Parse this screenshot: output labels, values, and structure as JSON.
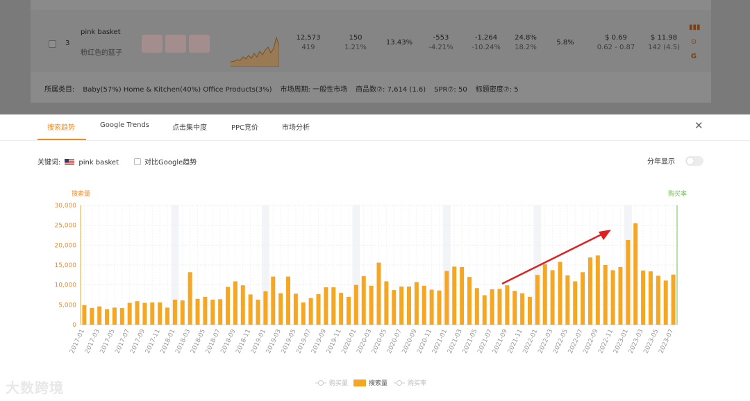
{
  "product_row": {
    "rank": "3",
    "name_en": "pink basket",
    "name_cn": "粉红色的篮子",
    "search_volume": "12,573",
    "search_volume_sub": "419",
    "purchases": "150",
    "purchases_sub": "1.21%",
    "purchase_rate": "13.43%",
    "change1": "-553",
    "change1_sub": "-4.21%",
    "change2": "-1,264",
    "change2_sub": "-10.24%",
    "click_share": "24.8%",
    "click_share_sub": "18.2%",
    "conversion": "5.8%",
    "ppc": "$ 0.69",
    "ppc_sub": "0.62 - 0.87",
    "price": "$ 11.98",
    "price_sub": "142 (4.5)"
  },
  "meta": {
    "category_label": "所属类目:",
    "categories": "Baby(57%)   Home & Kitchen(40%)   Office Products(3%)",
    "cycle": "市场周期: 一般性市场",
    "product_count": "商品数⑦: 7,614 (1.6)",
    "spr": "SPR⑦: 50",
    "title_density": "标题密度⑦: 5"
  },
  "tabs": [
    "搜索趋势",
    "Google Trends",
    "点击集中度",
    "PPC竞价",
    "市场分析"
  ],
  "keyword_label": "关键词:",
  "keyword": "pink basket",
  "compare_label": "对比Google趋势",
  "yearly_label": "分年显示",
  "watermark": "大数跨境",
  "colors": {
    "accent": "#f08a24",
    "bar": "#f5a623",
    "right_axis": "#6cc24a"
  },
  "chart_data": {
    "type": "bar",
    "ylabel_left": "搜索量",
    "ylabel_right": "购买率",
    "ylim": [
      0,
      30000
    ],
    "yticks": [
      "0",
      "5,000",
      "10,000",
      "15,000",
      "20,000",
      "25,000",
      "30,000"
    ],
    "legend": [
      "购买量",
      "搜索量",
      "购买率"
    ],
    "categories": [
      "2017-01",
      "2017-02",
      "2017-03",
      "2017-04",
      "2017-05",
      "2017-06",
      "2017-07",
      "2017-08",
      "2017-09",
      "2017-10",
      "2017-11",
      "2017-12",
      "2018-01",
      "2018-02",
      "2018-03",
      "2018-04",
      "2018-05",
      "2018-06",
      "2018-07",
      "2018-08",
      "2018-09",
      "2018-10",
      "2018-11",
      "2018-12",
      "2019-01",
      "2019-02",
      "2019-03",
      "2019-04",
      "2019-05",
      "2019-06",
      "2019-07",
      "2019-08",
      "2019-09",
      "2019-10",
      "2019-11",
      "2019-12",
      "2020-01",
      "2020-02",
      "2020-03",
      "2020-04",
      "2020-05",
      "2020-06",
      "2020-07",
      "2020-08",
      "2020-09",
      "2020-10",
      "2020-11",
      "2020-12",
      "2021-01",
      "2021-02",
      "2021-03",
      "2021-04",
      "2021-05",
      "2021-06",
      "2021-07",
      "2021-08",
      "2021-09",
      "2021-10",
      "2021-11",
      "2021-12",
      "2022-01",
      "2022-02",
      "2022-03",
      "2022-04",
      "2022-05",
      "2022-06",
      "2022-07",
      "2022-08",
      "2022-09",
      "2022-10",
      "2022-11",
      "2022-12",
      "2023-01",
      "2023-02",
      "2023-03",
      "2023-04",
      "2023-05",
      "2023-06",
      "2023-07"
    ],
    "xticks": [
      "2017-01",
      "2017-03",
      "2017-05",
      "2017-07",
      "2017-09",
      "2017-11",
      "2018-01",
      "2018-03",
      "2018-05",
      "2018-07",
      "2018-09",
      "2018-11",
      "2019-01",
      "2019-03",
      "2019-05",
      "2019-07",
      "2019-09",
      "2019-11",
      "2020-01",
      "2020-03",
      "2020-05",
      "2020-07",
      "2020-09",
      "2020-11",
      "2021-01",
      "2021-03",
      "2021-05",
      "2021-07",
      "2021-09",
      "2021-11",
      "2022-01",
      "2022-03",
      "2022-05",
      "2022-07",
      "2022-09",
      "2022-11",
      "2023-01",
      "2023-03",
      "2023-05",
      "2023-07"
    ],
    "series": [
      {
        "name": "搜索量",
        "values": [
          4900,
          4200,
          4600,
          3900,
          4300,
          4200,
          5500,
          5900,
          5500,
          5600,
          5600,
          4300,
          6300,
          6100,
          13200,
          6500,
          7000,
          6300,
          6400,
          9500,
          10900,
          9900,
          7600,
          6300,
          8400,
          12100,
          7900,
          12100,
          7800,
          5600,
          6700,
          7700,
          9400,
          9400,
          8000,
          7000,
          10000,
          12200,
          9800,
          15600,
          10900,
          8700,
          9600,
          9600,
          10700,
          9800,
          8800,
          8600,
          13500,
          14600,
          14500,
          12000,
          9200,
          7400,
          8900,
          9000,
          9900,
          8500,
          7900,
          7000,
          12500,
          15200,
          13700,
          15800,
          12400,
          10900,
          13200,
          16900,
          17400,
          15000,
          13700,
          14500,
          21300,
          25500,
          13600,
          13400,
          12300,
          11100,
          12600
        ]
      }
    ]
  }
}
